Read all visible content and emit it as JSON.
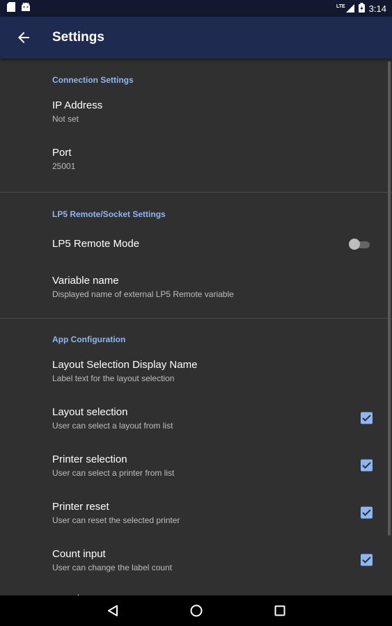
{
  "statusbar": {
    "time": "3:14",
    "network": "LTE"
  },
  "appbar": {
    "title": "Settings"
  },
  "sections": {
    "connection": {
      "header": "Connection Settings",
      "ip": {
        "title": "IP Address",
        "summary": "Not set"
      },
      "port": {
        "title": "Port",
        "summary": "25001"
      }
    },
    "lp5": {
      "header": "LP5 Remote/Socket Settings",
      "remote_mode": {
        "title": "LP5 Remote Mode",
        "checked": false
      },
      "variable_name": {
        "title": "Variable name",
        "summary": "Displayed name of external LP5 Remote variable"
      }
    },
    "app": {
      "header": "App Configuration",
      "layout_display_name": {
        "title": "Layout Selection Display Name",
        "summary": "Label text for the layout selection"
      },
      "layout_selection": {
        "title": "Layout selection",
        "summary": "User can select a layout from list",
        "checked": true
      },
      "printer_selection": {
        "title": "Printer selection",
        "summary": "User can select a printer from list",
        "checked": true
      },
      "printer_reset": {
        "title": "Printer reset",
        "summary": "User can reset the selected printer",
        "checked": true
      },
      "count_input": {
        "title": "Count input",
        "summary": "User can change the label count",
        "checked": true
      },
      "data_input": {
        "title": "Data input",
        "checked": true
      }
    }
  },
  "colors": {
    "accent": "#8fb6f0",
    "appbar": "#1f2a50",
    "background": "#303030"
  }
}
